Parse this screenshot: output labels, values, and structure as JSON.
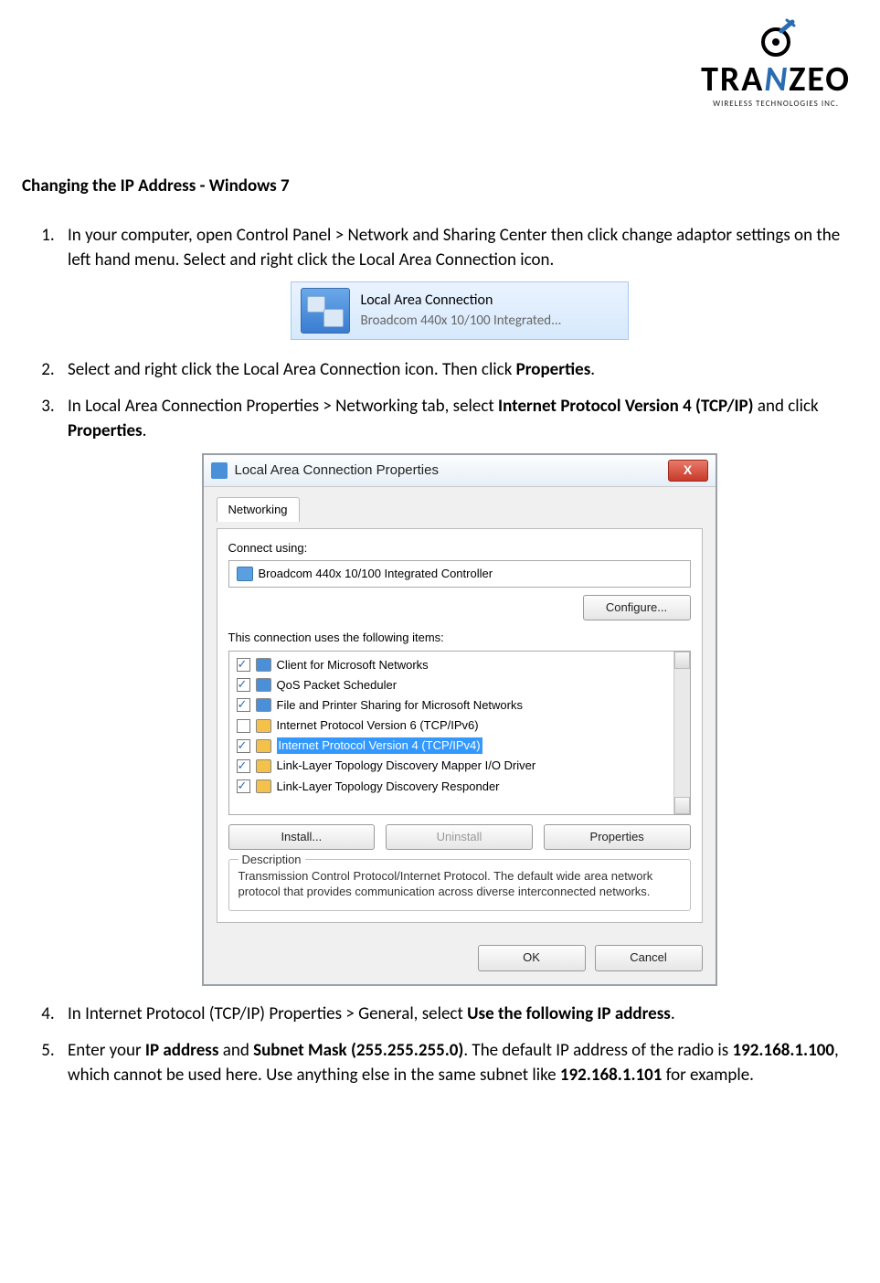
{
  "brand": {
    "name_pre": "TRA",
    "name_z": "N",
    "name_post": "ZEO",
    "tagline": "WIRELESS  TECHNOLOGIES INC."
  },
  "title": "Changing the IP Address - Windows 7",
  "steps": {
    "s1": "In your computer, open Control Panel > Network and Sharing Center then click change adaptor settings on the left hand menu. Select and right click the Local Area Connection icon.",
    "s2_a": "Select and right click the Local Area Connection icon. Then click ",
    "s2_b": "Properties",
    "s2_c": ".",
    "s3_a": "In Local Area Connection Properties > Networking tab, select ",
    "s3_b": "Internet Protocol Version 4 (TCP/IP)",
    "s3_c": " and click ",
    "s3_d": "Properties",
    "s3_e": ".",
    "s4_a": "In Internet Protocol (TCP/IP) Properties > General, select ",
    "s4_b": "Use the following IP address",
    "s4_c": ".",
    "s5_a": "Enter your ",
    "s5_b": "IP address",
    "s5_c": " and ",
    "s5_d": "Subnet Mask (255.255.255.0)",
    "s5_e": ". The default IP address of the radio is ",
    "s5_f": "192.168.1.100",
    "s5_g": ", which cannot be used here. Use anything else in the same subnet like ",
    "s5_h": "192.168.1.101",
    "s5_i": " for example."
  },
  "fig1": {
    "title": "Local Area Connection",
    "subtitle": "Broadcom 440x 10/100 Integrated..."
  },
  "dlg": {
    "title": "Local Area Connection Properties",
    "close": "X",
    "tab": "Networking",
    "connect_label": "Connect using:",
    "adapter": "Broadcom 440x 10/100 Integrated Controller",
    "configure": "Configure...",
    "uses_label": "This connection uses the following items:",
    "items": {
      "i0": "Client for Microsoft Networks",
      "i1": "QoS Packet Scheduler",
      "i2": "File and Printer Sharing for Microsoft Networks",
      "i3": "Internet Protocol Version 6 (TCP/IPv6)",
      "i4": "Internet Protocol Version 4 (TCP/IPv4)",
      "i5": "Link-Layer Topology Discovery Mapper I/O Driver",
      "i6": "Link-Layer Topology Discovery Responder"
    },
    "install": "Install...",
    "uninstall": "Uninstall",
    "properties": "Properties",
    "desc_legend": "Description",
    "desc_text": "Transmission Control Protocol/Internet Protocol. The default wide area network protocol that provides communication across diverse interconnected networks.",
    "ok": "OK",
    "cancel": "Cancel"
  }
}
